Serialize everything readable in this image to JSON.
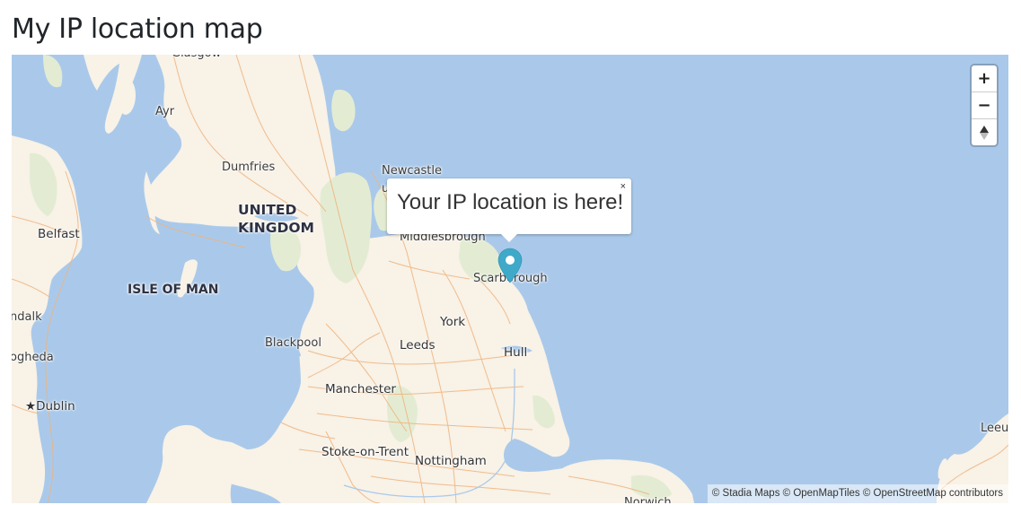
{
  "page": {
    "title": "My IP location map"
  },
  "map": {
    "colors": {
      "sea": "#aac9ea",
      "land": "#f8f2e7",
      "park": "#e3ecd3",
      "road": "#f0b27a",
      "marker": "#3fa9c9"
    },
    "controls": {
      "zoom_in": "+",
      "zoom_out": "−",
      "reset_bearing_icon": "compass-icon"
    },
    "popup": {
      "text": "Your IP location is here!",
      "close": "×"
    },
    "marker": {
      "location": "Scarborough",
      "icon": "map-pin-icon"
    },
    "labels": {
      "glasgow": "Glasgow",
      "ayr": "Ayr",
      "dumfries": "Dumfries",
      "newcastle": "Newcastle",
      "newcastle_upon": "u",
      "united": "UNITED",
      "kingdom": "KINGDOM",
      "belfast": "Belfast",
      "middlesbrough": "Middlesbrough",
      "scarborough": "Scarborough",
      "isle_of_man": "ISLE OF MAN",
      "dundalk": "ndalk",
      "york": "York",
      "blackpool": "Blackpool",
      "leeds": "Leeds",
      "drogheda": "ogheda",
      "hull": "Hull",
      "dublin": "★Dublin",
      "manchester": "Manchester",
      "stoke": "Stoke-on-Trent",
      "nottingham": "Nottingham",
      "leeuwarden": "Leeu",
      "norwich": "Norwich"
    },
    "attribution": "© Stadia Maps © OpenMapTiles © OpenStreetMap contributors"
  }
}
